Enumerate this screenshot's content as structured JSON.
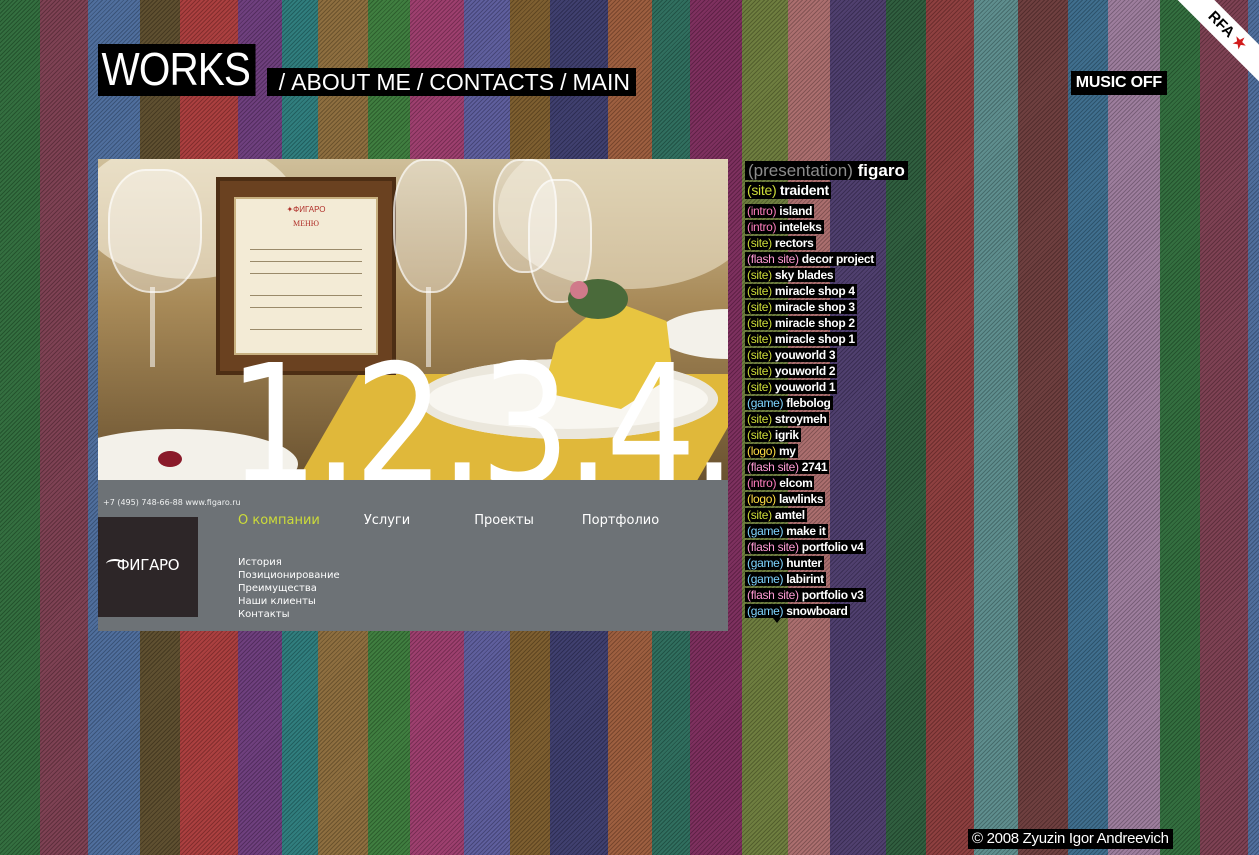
{
  "colors": {
    "stripes": [
      "#2e6a3a",
      "#7a3c4e",
      "#4a6a9a",
      "#5a4a2a",
      "#a83a3a",
      "#6a3a7a",
      "#2a7a7a",
      "#8a6a3a",
      "#3a7a3a",
      "#9a3a6a",
      "#5a5a9a",
      "#7a5a2a",
      "#3a3a6a",
      "#9a5a3a",
      "#2a6a5a",
      "#7a2a5a",
      "#6a7a3a",
      "#a86a6a",
      "#4a3a6a",
      "#2a5a3a",
      "#8a3a3a",
      "#5a8a8a",
      "#6a3a3a",
      "#3a6a8a",
      "#9a7a9a"
    ],
    "site": "#cddc39",
    "intro": "#ff7fbf",
    "flash site": "#ff9bd4",
    "game": "#7fd4ff",
    "logo": "#ffdd44",
    "presentation": "#8c8c8c"
  },
  "nav": {
    "works": "WORKS",
    "sep1": "/",
    "about": "ABOUT ME",
    "sep2": "/",
    "contacts": "CONTACTS",
    "sep3": "/",
    "main": "MAIN"
  },
  "music": "MUSIC OFF",
  "rfa": "RFA",
  "preview": {
    "menu_card_logo": "✦ФИГАРО",
    "menu_card_title": "МЕНЮ",
    "big_number": "1.2.3.4.",
    "contact": "+7 (495) 748-66-88   www.figaro.ru",
    "logo": "ФИГАРО",
    "menu_top": [
      "О компании",
      "Услуги",
      "Проекты",
      "Портфолио"
    ],
    "menu_sub": [
      "История",
      "Позиционирование",
      "Преимущества",
      "Наши клиенты",
      "Контакты"
    ]
  },
  "list": {
    "head": {
      "type": "(presentation)",
      "name": "figaro"
    },
    "items": [
      {
        "type": "(site)",
        "cat": "site",
        "name": "traident",
        "big": true
      },
      {
        "type": "(intro)",
        "cat": "intro",
        "name": "island"
      },
      {
        "type": "(intro)",
        "cat": "intro",
        "name": "inteleks"
      },
      {
        "type": "(site)",
        "cat": "site",
        "name": "rectors"
      },
      {
        "type": "(flash site)",
        "cat": "flash site",
        "name": "decor project"
      },
      {
        "type": "(site)",
        "cat": "site",
        "name": "sky blades"
      },
      {
        "type": "(site)",
        "cat": "site",
        "name": "miracle shop 4"
      },
      {
        "type": "(site)",
        "cat": "site",
        "name": "miracle shop 3"
      },
      {
        "type": "(site)",
        "cat": "site",
        "name": "miracle shop 2"
      },
      {
        "type": "(site)",
        "cat": "site",
        "name": "miracle shop 1"
      },
      {
        "type": "(site)",
        "cat": "site",
        "name": "youworld 3"
      },
      {
        "type": "(site)",
        "cat": "site",
        "name": "youworld 2"
      },
      {
        "type": "(site)",
        "cat": "site",
        "name": "youworld 1"
      },
      {
        "type": "(game)",
        "cat": "game",
        "name": "flebolog"
      },
      {
        "type": "(site)",
        "cat": "site",
        "name": "stroymeh"
      },
      {
        "type": "(site)",
        "cat": "site",
        "name": "igrik"
      },
      {
        "type": "(logo)",
        "cat": "logo",
        "name": "my"
      },
      {
        "type": "(flash site)",
        "cat": "flash site",
        "name": "2741"
      },
      {
        "type": "(intro)",
        "cat": "intro",
        "name": "elcom"
      },
      {
        "type": "(logo)",
        "cat": "logo",
        "name": "lawlinks"
      },
      {
        "type": "(site)",
        "cat": "site",
        "name": "amtel"
      },
      {
        "type": "(game)",
        "cat": "game",
        "name": "make it"
      },
      {
        "type": "(flash site)",
        "cat": "flash site",
        "name": "portfolio v4"
      },
      {
        "type": "(game)",
        "cat": "game",
        "name": "hunter"
      },
      {
        "type": "(game)",
        "cat": "game",
        "name": "labirint"
      },
      {
        "type": "(flash site)",
        "cat": "flash site",
        "name": "portfolio v3"
      },
      {
        "type": "(game)",
        "cat": "game",
        "name": "snowboard"
      }
    ]
  },
  "copyright": "© 2008 Zyuzin Igor Andreevich"
}
